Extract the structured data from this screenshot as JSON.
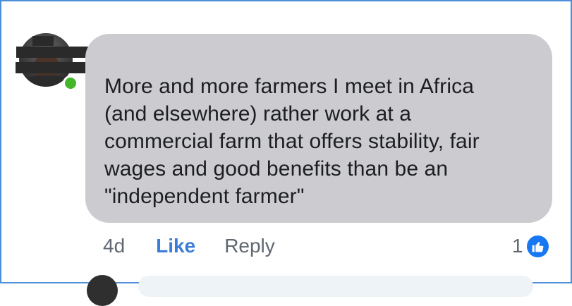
{
  "comment": {
    "author_name": "",
    "text": "More and more farmers I meet in Africa\n(and elsewhere) rather work at a\ncommercial farm that offers stability, fair\nwages and good benefits than be an\n\"independent farmer\"",
    "time": "4d",
    "like_label": "Like",
    "reply_label": "Reply",
    "reaction_count": "1",
    "reaction_icon": "like-thumb-icon",
    "online": true
  },
  "colors": {
    "bubble": "#ccccd0",
    "like_blue": "#3b7dd8",
    "online_green": "#42b72a",
    "frame_border": "#4d8fd6"
  }
}
